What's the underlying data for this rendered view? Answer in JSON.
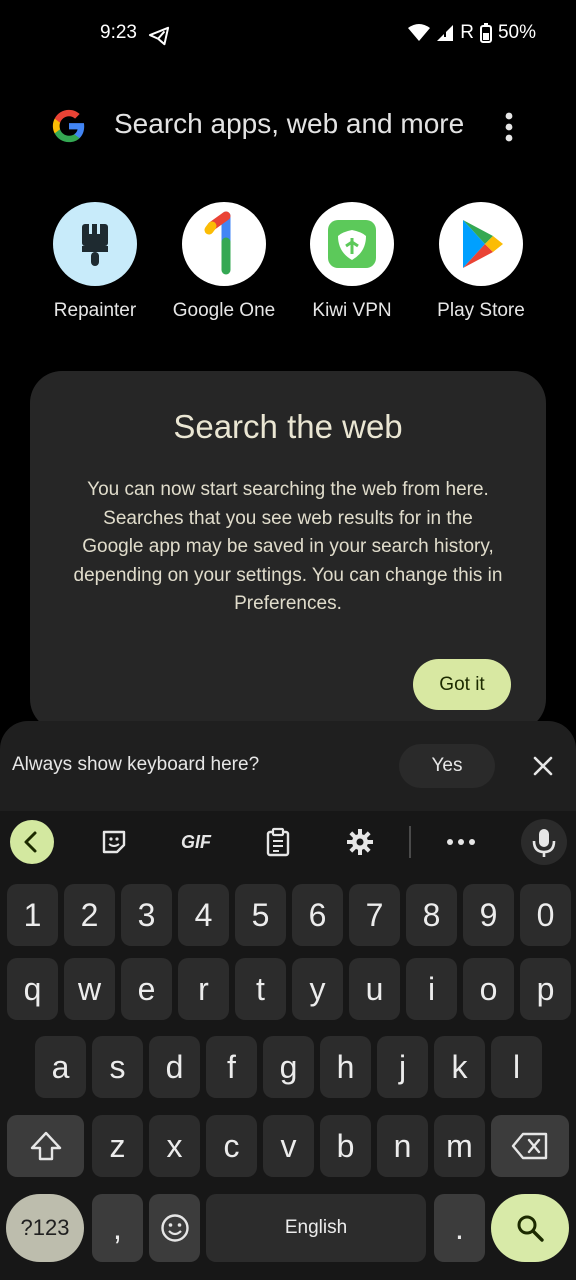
{
  "status_bar": {
    "time": "9:23",
    "network": "R",
    "battery": "50%"
  },
  "search": {
    "placeholder": "Search apps, web and more"
  },
  "apps": [
    {
      "label": "Repainter"
    },
    {
      "label": "Google One"
    },
    {
      "label": "Kiwi VPN"
    },
    {
      "label": "Play Store"
    }
  ],
  "card": {
    "title": "Search the web",
    "body": "You can now start searching the web from here. Searches that you see web results for in the Google app may be saved in your search history, depending on your settings. You can change this in Preferences.",
    "button": "Got it"
  },
  "keyboard_prompt": {
    "text": "Always show keyboard here?",
    "yes": "Yes"
  },
  "toolbar": {
    "gif": "GIF"
  },
  "keyboard": {
    "row_numbers": [
      "1",
      "2",
      "3",
      "4",
      "5",
      "6",
      "7",
      "8",
      "9",
      "0"
    ],
    "row_q": [
      "q",
      "w",
      "e",
      "r",
      "t",
      "y",
      "u",
      "i",
      "o",
      "p"
    ],
    "row_a": [
      "a",
      "s",
      "d",
      "f",
      "g",
      "h",
      "j",
      "k",
      "l"
    ],
    "row_z": [
      "z",
      "x",
      "c",
      "v",
      "b",
      "n",
      "m"
    ],
    "symbols": "?123",
    "comma": ",",
    "space": "English",
    "period": "."
  },
  "colors": {
    "background": "#000000",
    "card": "#262626",
    "accent_green": "#d8e8a2",
    "keyboard_bg": "#171717"
  }
}
